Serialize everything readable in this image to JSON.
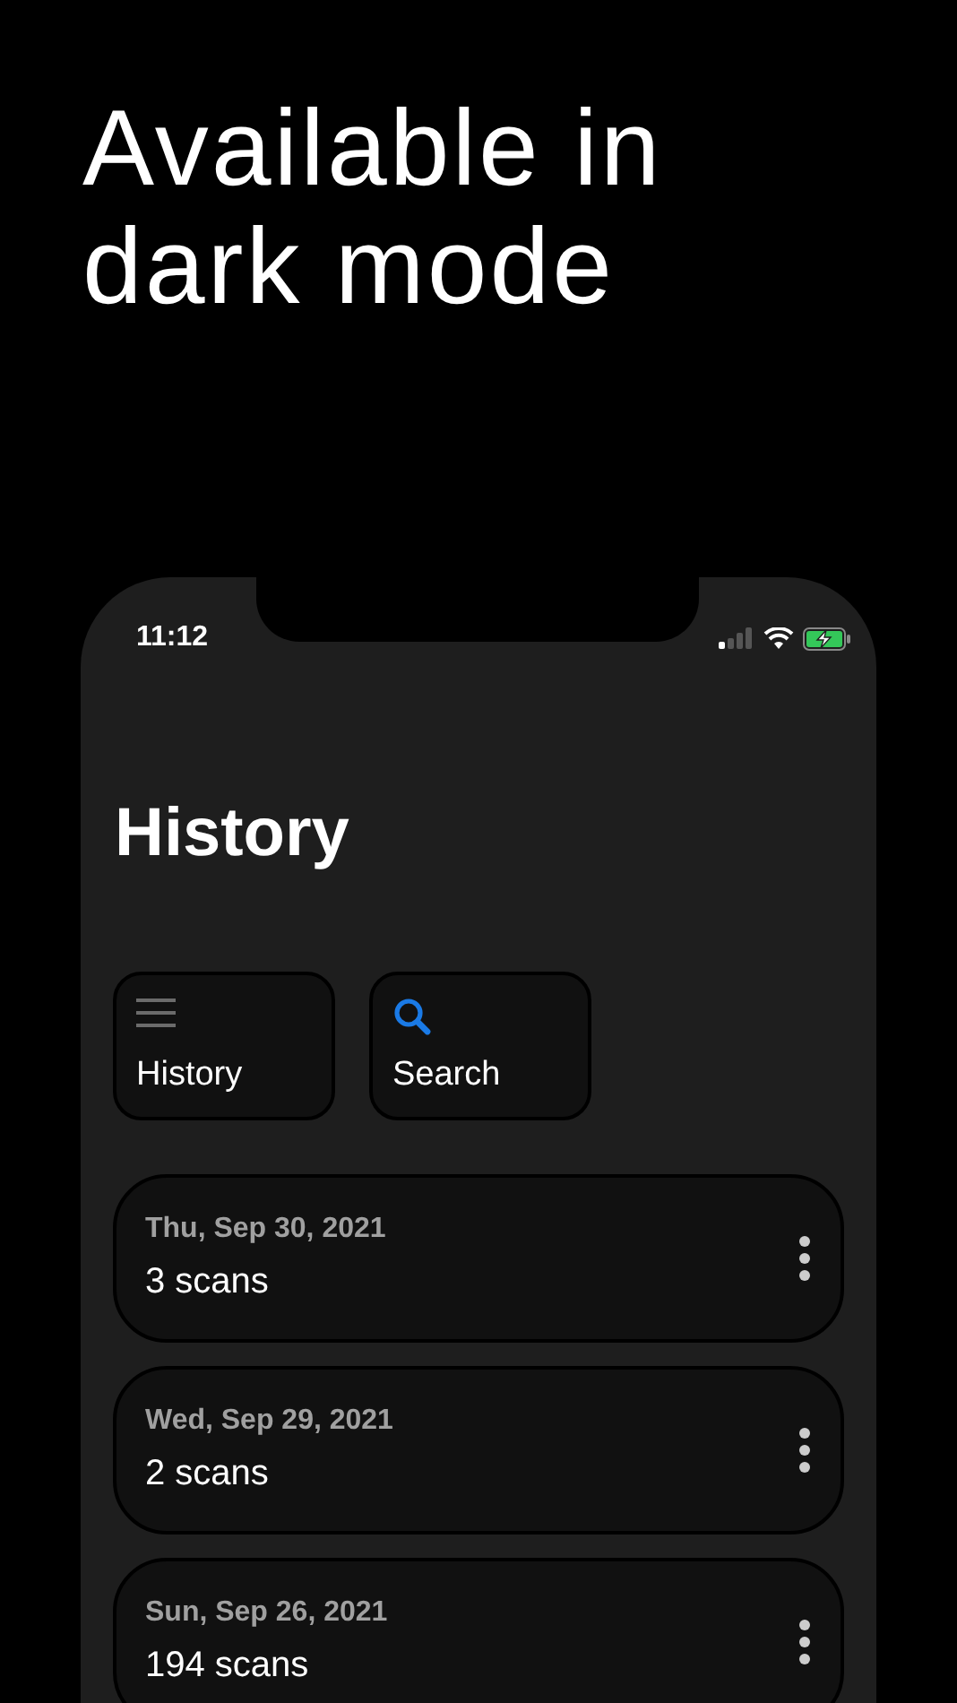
{
  "headline": "Available in dark mode",
  "status_bar": {
    "time": "11:12"
  },
  "page_title": "History",
  "tiles": [
    {
      "kind": "menu",
      "label": "History"
    },
    {
      "kind": "search",
      "label": "Search"
    }
  ],
  "history": [
    {
      "date": "Thu, Sep 30, 2021",
      "count": "3 scans"
    },
    {
      "date": "Wed, Sep 29, 2021",
      "count": "2 scans"
    },
    {
      "date": "Sun, Sep 26, 2021",
      "count": "194 scans"
    }
  ]
}
